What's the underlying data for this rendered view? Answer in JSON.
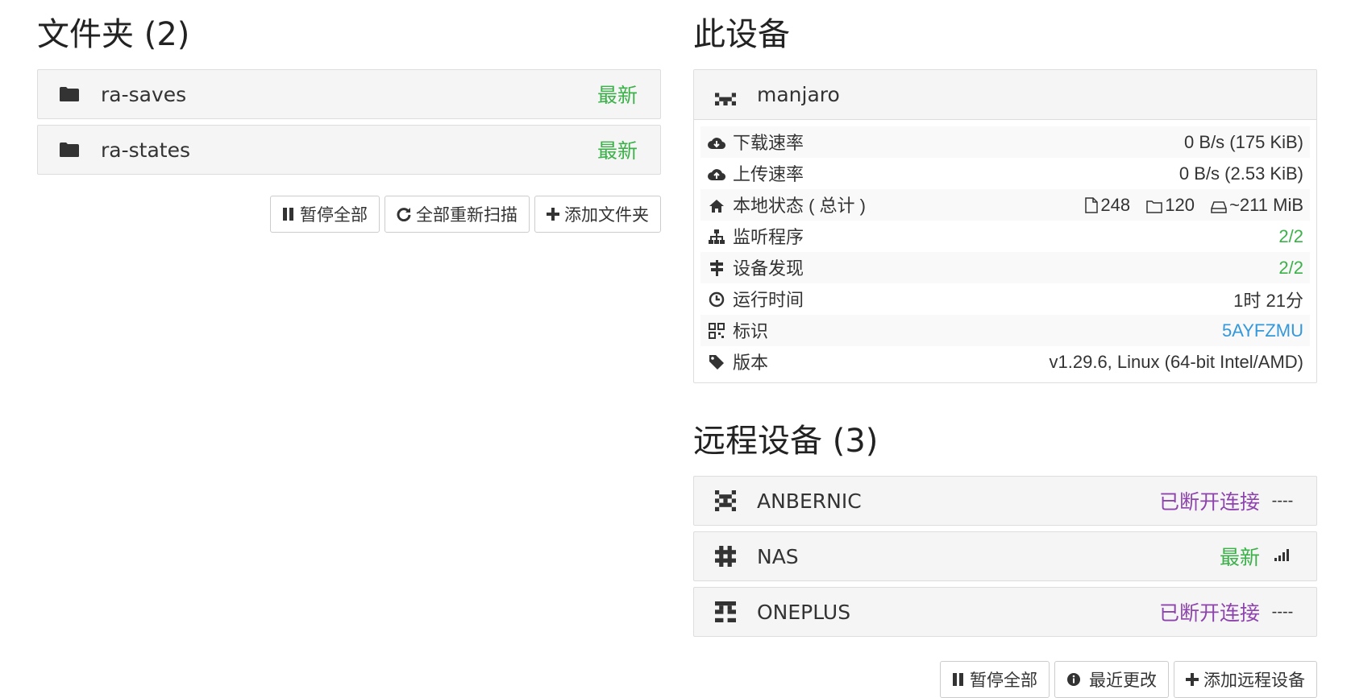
{
  "folders": {
    "title": "文件夹 (2)",
    "items": [
      {
        "name": "ra-saves",
        "status": "最新"
      },
      {
        "name": "ra-states",
        "status": "最新"
      }
    ],
    "buttons": {
      "pause_all": "暂停全部",
      "rescan_all": "全部重新扫描",
      "add_folder": "添加文件夹"
    }
  },
  "this_device": {
    "title": "此设备",
    "name": "manjaro",
    "rows": [
      {
        "label": "下载速率",
        "value": "0 B/s (175 KiB)"
      },
      {
        "label": "上传速率",
        "value": "0 B/s (2.53 KiB)"
      },
      {
        "label": "本地状态 ( 总计 )",
        "files": "248",
        "dirs": "120",
        "size": "~211 MiB"
      },
      {
        "label": "监听程序",
        "value": "2/2"
      },
      {
        "label": "设备发现",
        "value": "2/2"
      },
      {
        "label": "运行时间",
        "value": "1时 21分"
      },
      {
        "label": "标识",
        "value": "5AYFZMU"
      },
      {
        "label": "版本",
        "value": "v1.29.6, Linux (64-bit Intel/AMD)"
      }
    ]
  },
  "remote_devices": {
    "title": "远程设备 (3)",
    "items": [
      {
        "name": "ANBERNIC",
        "status": "已断开连接",
        "indicator": "----"
      },
      {
        "name": "NAS",
        "status": "最新",
        "indicator": "signal-icon"
      },
      {
        "name": "ONEPLUS",
        "status": "已断开连接",
        "indicator": "----"
      }
    ],
    "buttons": {
      "pause_all": "暂停全部",
      "recent_changes": "最近更改",
      "add_remote": "添加远程设备"
    }
  },
  "colors": {
    "green": "#3cb14a",
    "purple": "#8e44ad",
    "blue": "#3498db"
  }
}
